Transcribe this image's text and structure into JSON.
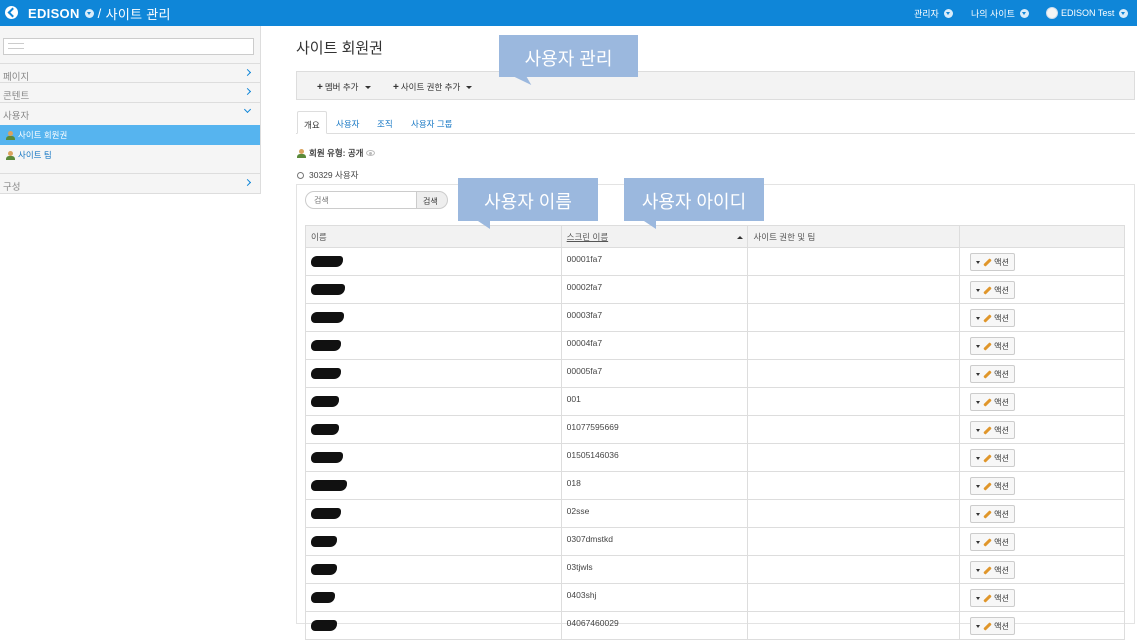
{
  "topbar": {
    "title": "EDISON",
    "separator": "/",
    "page": "사이트 관리",
    "nav": [
      {
        "label": "관리자"
      },
      {
        "label": "나의 사이트"
      },
      {
        "label": "EDISON Test"
      }
    ]
  },
  "sidebar": {
    "sections": [
      {
        "label": "페이지"
      },
      {
        "label": "콘텐트"
      },
      {
        "label": "사용자"
      },
      {
        "label": "구성"
      }
    ],
    "items": [
      {
        "label": "사이트 회원권"
      },
      {
        "label": "사이트 팀"
      }
    ]
  },
  "main": {
    "title": "사이트 회원권",
    "toolbar": {
      "add_member": "멤버 추가",
      "add_role": "사이트 권한 추가"
    },
    "tabs": [
      {
        "label": "개요"
      },
      {
        "label": "사용자"
      },
      {
        "label": "조직"
      },
      {
        "label": "사용자 그룹"
      }
    ],
    "member_type_label": "회원 유형: 공개",
    "user_count": "30329 사용자",
    "search": {
      "placeholder": "검색",
      "button": "검색"
    },
    "table": {
      "headers": [
        "이름",
        "스크린 이름",
        "사이트 권한 및 팀",
        ""
      ],
      "action_label": "액션",
      "rows": [
        {
          "screen": "00001fa7"
        },
        {
          "screen": "00002fa7"
        },
        {
          "screen": "00003fa7"
        },
        {
          "screen": "00004fa7"
        },
        {
          "screen": "00005fa7"
        },
        {
          "screen": "001"
        },
        {
          "screen": "01077595669"
        },
        {
          "screen": "01505146036"
        },
        {
          "screen": "018"
        },
        {
          "screen": "02sse"
        },
        {
          "screen": "0307dmstkd"
        },
        {
          "screen": "03tjwls"
        },
        {
          "screen": "0403shj"
        },
        {
          "screen": "04067460029"
        }
      ]
    }
  },
  "callouts": {
    "user_management": "사용자 관리",
    "user_name": "사용자 이름",
    "user_id": "사용자 아이디"
  }
}
